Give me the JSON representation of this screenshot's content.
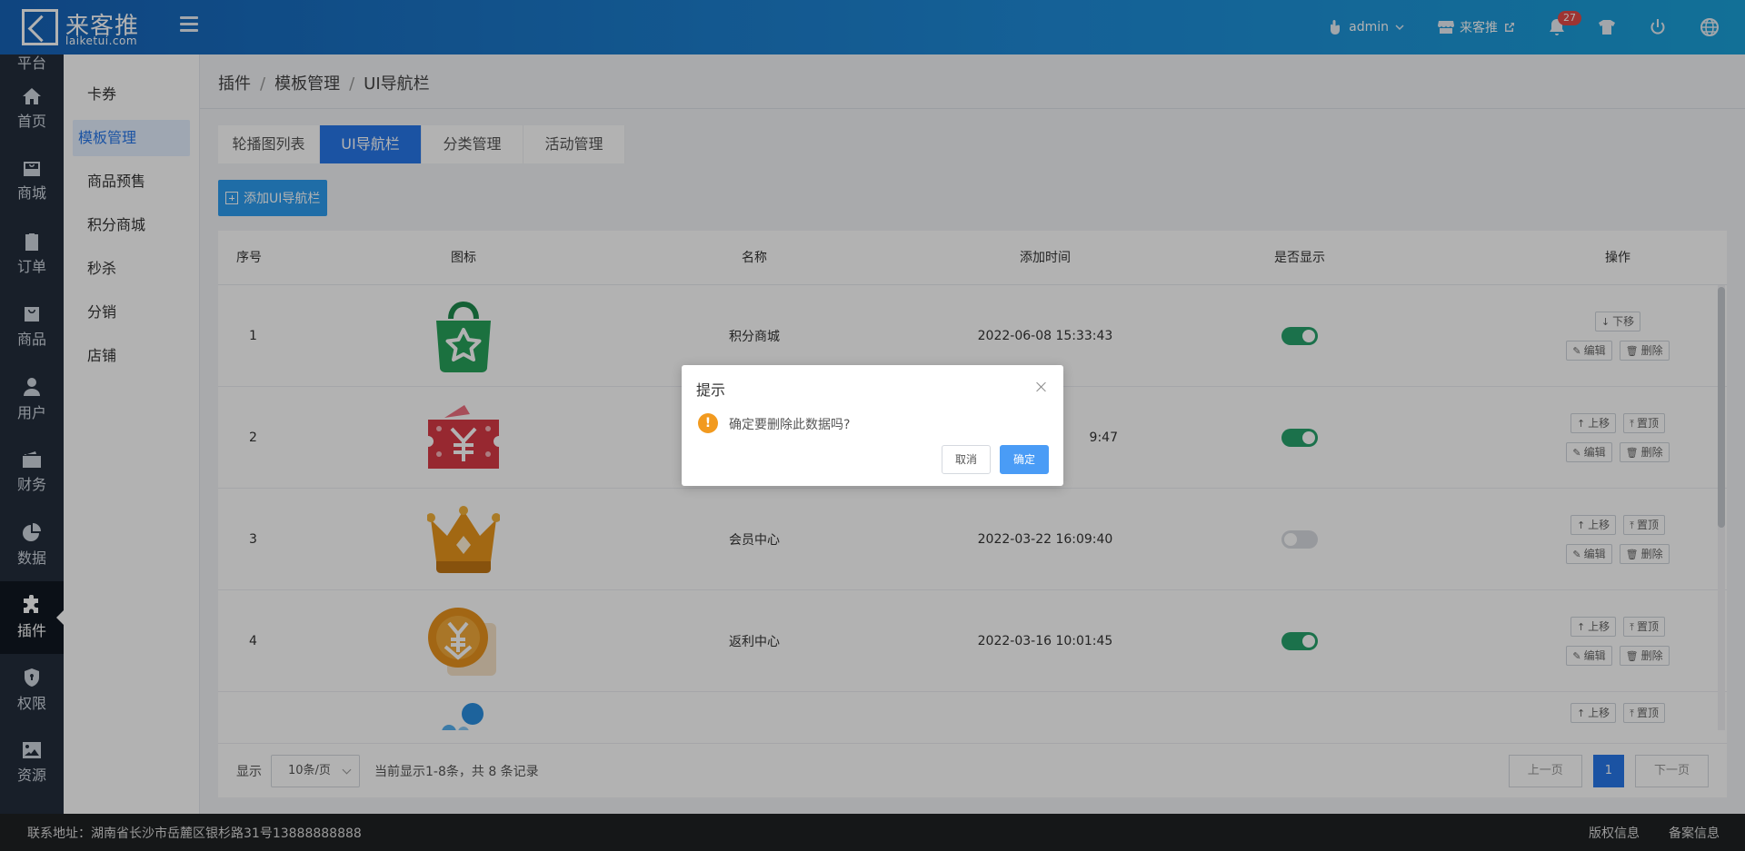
{
  "header": {
    "logo_name": "来客推",
    "logo_domain": "laiketui.com",
    "user_label": "admin",
    "store_label": "来客推",
    "notification_count": "27"
  },
  "leftnav": {
    "partial_label": "平台",
    "items": [
      {
        "label": "首页",
        "icon": "home-icon"
      },
      {
        "label": "商城",
        "icon": "mall-icon"
      },
      {
        "label": "订单",
        "icon": "order-icon"
      },
      {
        "label": "商品",
        "icon": "goods-icon"
      },
      {
        "label": "用户",
        "icon": "user-icon"
      },
      {
        "label": "财务",
        "icon": "wallet-icon"
      },
      {
        "label": "数据",
        "icon": "pie-chart-icon"
      },
      {
        "label": "插件",
        "icon": "puzzle-icon"
      },
      {
        "label": "权限",
        "icon": "shield-icon"
      },
      {
        "label": "资源",
        "icon": "image-icon"
      }
    ],
    "active": "插件"
  },
  "subnav": {
    "items": [
      "卡券",
      "模板管理",
      "商品预售",
      "积分商城",
      "秒杀",
      "分销",
      "店铺"
    ],
    "active": "模板管理"
  },
  "breadcrumb": {
    "items": [
      "插件",
      "模板管理",
      "UI导航栏"
    ],
    "separator": "/"
  },
  "tabs": {
    "items": [
      "轮播图列表",
      "UI导航栏",
      "分类管理",
      "活动管理"
    ],
    "active": "UI导航栏"
  },
  "add_button": "添加UI导航栏",
  "table": {
    "columns": [
      "序号",
      "图标",
      "名称",
      "添加时间",
      "是否显示",
      "操作"
    ],
    "rows": [
      {
        "index": "1",
        "name": "积分商城",
        "time": "2022-06-08 15:33:43",
        "shown": true,
        "icon": "shopping-bag-star-icon"
      },
      {
        "index": "2",
        "name": "",
        "time": "9:47",
        "shown": true,
        "icon": "coupon-yen-icon"
      },
      {
        "index": "3",
        "name": "会员中心",
        "time": "2022-03-22 16:09:40",
        "shown": false,
        "icon": "crown-icon"
      },
      {
        "index": "4",
        "name": "返利中心",
        "time": "2022-03-16 10:01:45",
        "shown": true,
        "icon": "rebate-yen-icon"
      }
    ],
    "ops": {
      "down": "下移",
      "up": "上移",
      "top": "置顶",
      "edit": "编辑",
      "delete": "删除"
    }
  },
  "pagination": {
    "show_label": "显示",
    "page_size": "10条/页",
    "summary": "当前显示1-8条，共 8 条记录",
    "prev": "上一页",
    "current": "1",
    "next": "下一页"
  },
  "footer": {
    "address": "联系地址：湖南省长沙市岳麓区银杉路31号13888888888",
    "links": [
      "版权信息",
      "备案信息"
    ]
  },
  "dialog": {
    "title": "提示",
    "message": "确定要删除此数据吗?",
    "cancel": "取消",
    "confirm": "确定"
  },
  "colors": {
    "primary": "#2878ea",
    "switch_on": "#27a36c",
    "warning": "#f29a1f"
  }
}
